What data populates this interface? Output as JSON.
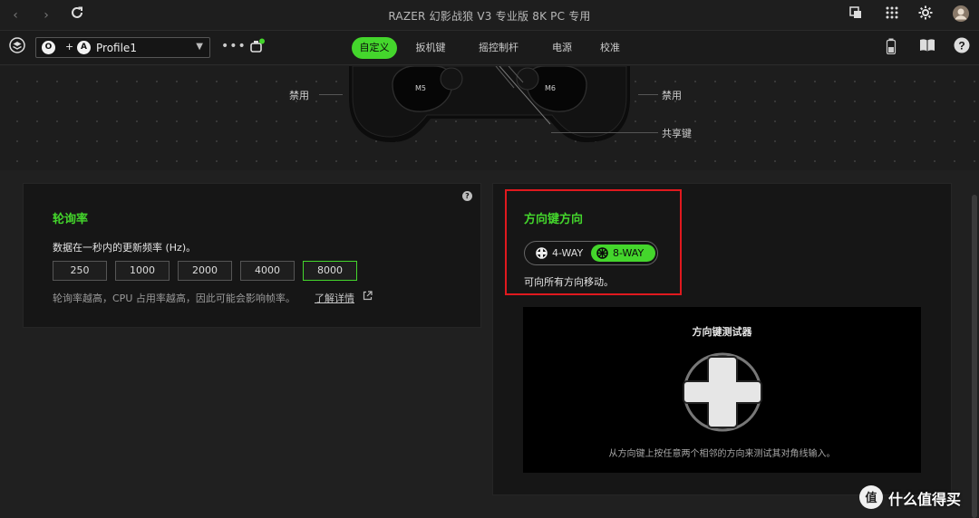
{
  "window": {
    "title": "RAZER 幻影战狼 V3 专业版 8K PC 专用"
  },
  "toolbar": {
    "profile_a": "O",
    "profile_plus": "+",
    "profile_b": "A",
    "profile_name": "Profile1",
    "more": "•••",
    "tabs": [
      {
        "label": "自定义",
        "active": true
      },
      {
        "label": "扳机键",
        "active": false
      },
      {
        "label": "摇控制杆",
        "active": false
      },
      {
        "label": "电源",
        "active": false
      },
      {
        "label": "校准",
        "active": false
      }
    ]
  },
  "controller": {
    "left_label": "禁用",
    "right_label": "禁用",
    "share_label": "共享键",
    "m5": "M5",
    "m6": "M6"
  },
  "polling": {
    "title": "轮询率",
    "help": "?",
    "description": "数据在一秒内的更新频率 (Hz)。",
    "options": [
      "250",
      "1000",
      "2000",
      "4000",
      "8000"
    ],
    "selected": "8000",
    "note": "轮询率越高，CPU 占用率越高，因此可能会影响帧率。",
    "link": "了解详情"
  },
  "dpad": {
    "title": "方向键方向",
    "option_4way": "4-WAY",
    "option_8way": "8-WAY",
    "selected": "8-WAY",
    "description": "可向所有方向移动。",
    "tester_title": "方向键测试器",
    "tester_hint": "从方向键上按任意两个相邻的方向来测试其对角线输入。"
  },
  "colors": {
    "accent": "#44d62c",
    "highlight": "#e0191e"
  },
  "watermark": {
    "text": "什么值得买"
  }
}
